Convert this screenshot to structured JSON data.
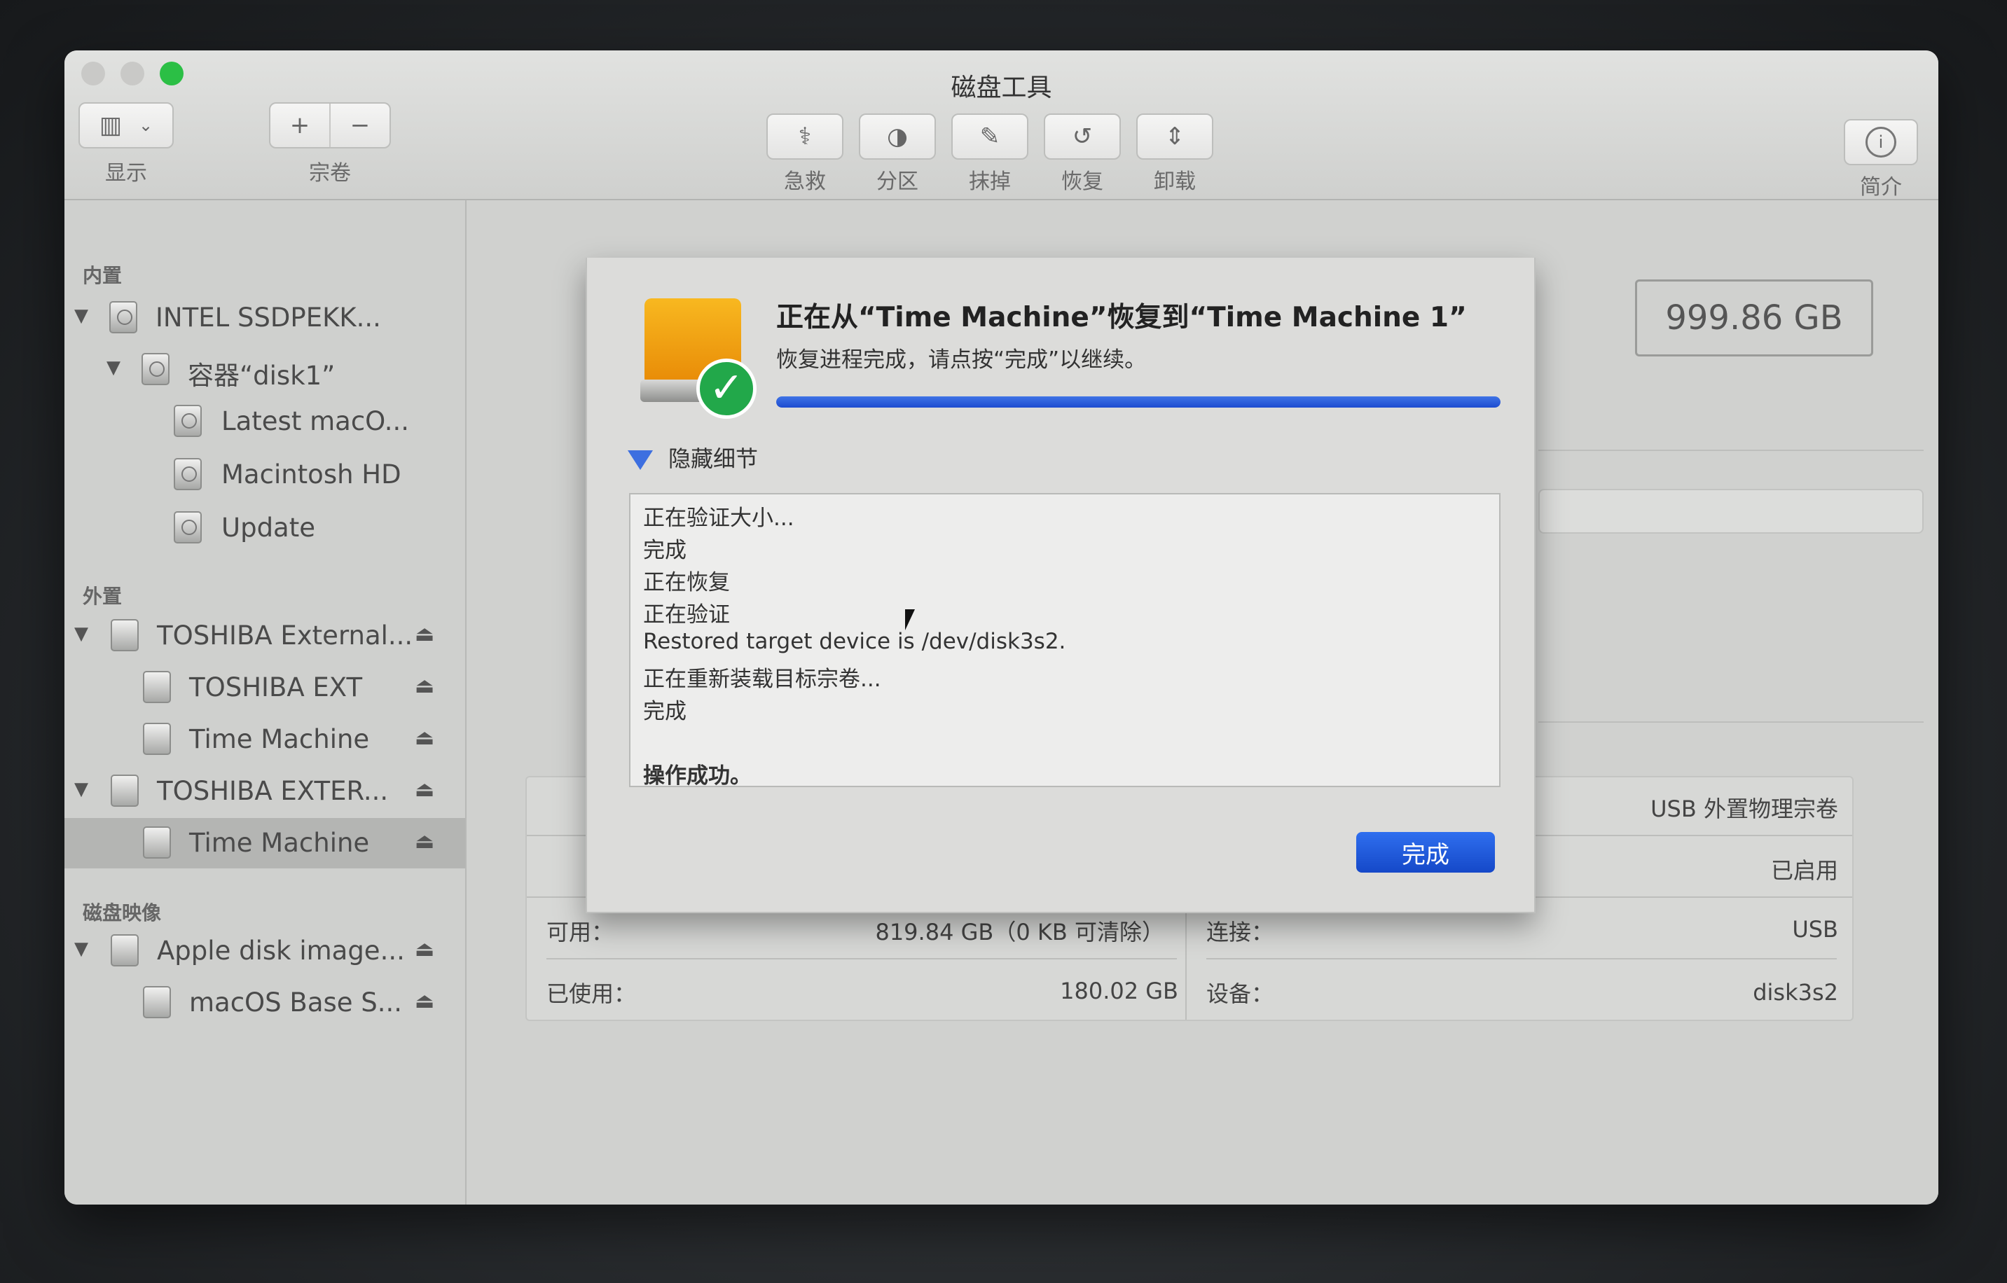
{
  "window": {
    "title": "磁盘工具"
  },
  "toolbar": {
    "view_label": "显示",
    "volume_label": "宗卷",
    "volume_add": "+",
    "volume_remove": "−",
    "actions": [
      {
        "label": "急救",
        "icon": "stethoscope-icon"
      },
      {
        "label": "分区",
        "icon": "partition-icon"
      },
      {
        "label": "抹掉",
        "icon": "erase-icon"
      },
      {
        "label": "恢复",
        "icon": "restore-icon"
      },
      {
        "label": "卸载",
        "icon": "unmount-icon"
      }
    ],
    "info_label": "简介"
  },
  "sidebar": {
    "internal_header": "内置",
    "external_header": "外置",
    "images_header": "磁盘映像",
    "items": [
      {
        "label": "INTEL SSDPEKK..."
      },
      {
        "label": "容器“disk1”"
      },
      {
        "label": "Latest macO..."
      },
      {
        "label": "Macintosh HD"
      },
      {
        "label": "Update"
      },
      {
        "label": "TOSHIBA External..."
      },
      {
        "label": "TOSHIBA EXT"
      },
      {
        "label": "Time Machine"
      },
      {
        "label": "TOSHIBA EXTER..."
      },
      {
        "label": "Time Machine",
        "selected": true
      },
      {
        "label": "Apple disk image..."
      },
      {
        "label": "macOS Base S..."
      }
    ]
  },
  "main": {
    "capacity": "999.86 GB",
    "info": {
      "type_value": "USB 外置物理宗卷",
      "owners_value": "已启用",
      "available_key": "可用：",
      "available_value": "819.84 GB（0 KB 可清除）",
      "connection_key": "连接：",
      "connection_value": "USB",
      "used_key": "已使用：",
      "used_value": "180.02 GB",
      "device_key": "设备：",
      "device_value": "disk3s2"
    }
  },
  "sheet": {
    "title": "正在从“Time Machine”恢复到“Time Machine 1”",
    "message": "恢复进程完成，请点按“完成”以继续。",
    "progress": 1.0,
    "details_toggle": "隐藏细节",
    "log": [
      "正在验证大小...",
      "完成",
      "正在恢复",
      "正在验证",
      "Restored target device is /dev/disk3s2.",
      "正在重新装载目标宗卷...",
      "完成",
      "",
      "操作成功。"
    ],
    "done_button": "完成"
  },
  "colors": {
    "accent": "#1d4bd0",
    "success": "#22a84a",
    "disk_orange": "#f0a010"
  }
}
